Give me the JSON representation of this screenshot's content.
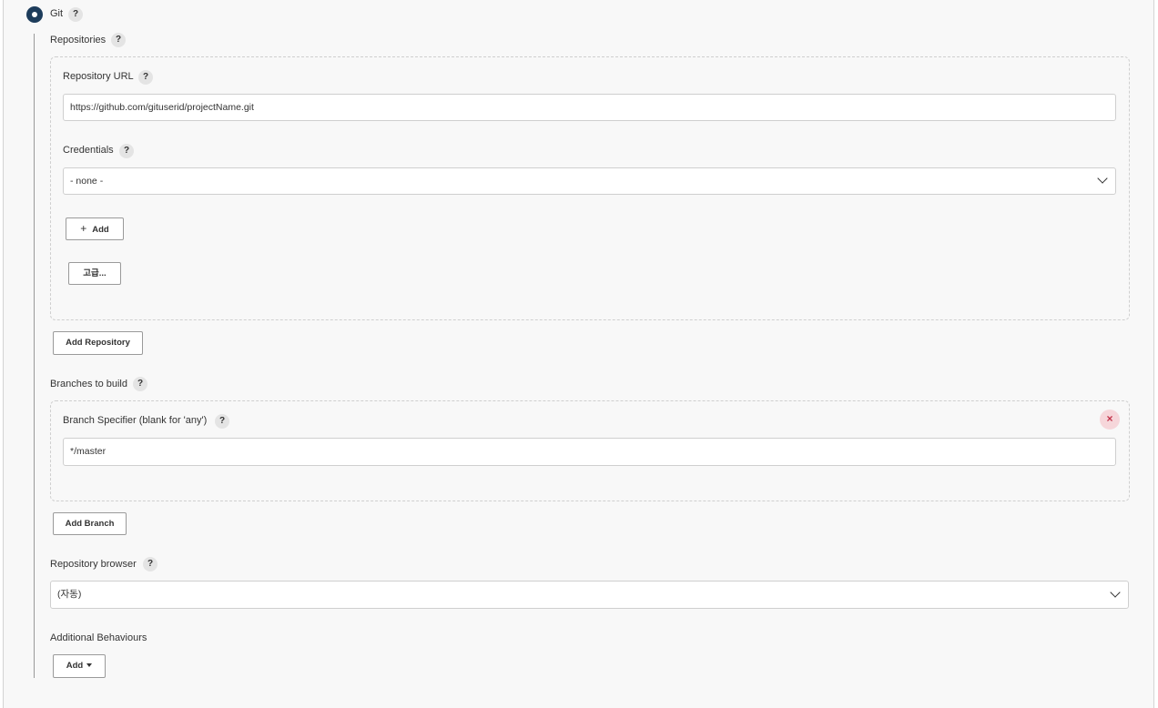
{
  "scm": {
    "selected_option_label": "Git",
    "help_label": "?"
  },
  "repositories": {
    "label": "Repositories",
    "url_label": "Repository URL",
    "url_value": "https://github.com/gituserid/projectName.git",
    "credentials_label": "Credentials",
    "credentials_value": "- none -",
    "add_button_label": "Add",
    "add_button_icon": "+",
    "advanced_button_label": "고급...",
    "add_repository_label": "Add Repository"
  },
  "branches": {
    "label": "Branches to build",
    "specifier_label": "Branch Specifier (blank for 'any')",
    "specifier_value": "*/master",
    "remove_icon_glyph": "×",
    "add_branch_label": "Add Branch"
  },
  "repo_browser": {
    "label": "Repository browser",
    "value": "(자동)"
  },
  "additional": {
    "label": "Additional Behaviours",
    "add_label": "Add"
  },
  "colors": {
    "radio": "#1d3c5b",
    "panel_bg": "#f8f8f8",
    "remove_bg": "#f6d6da",
    "remove_fg": "#c2334a"
  }
}
